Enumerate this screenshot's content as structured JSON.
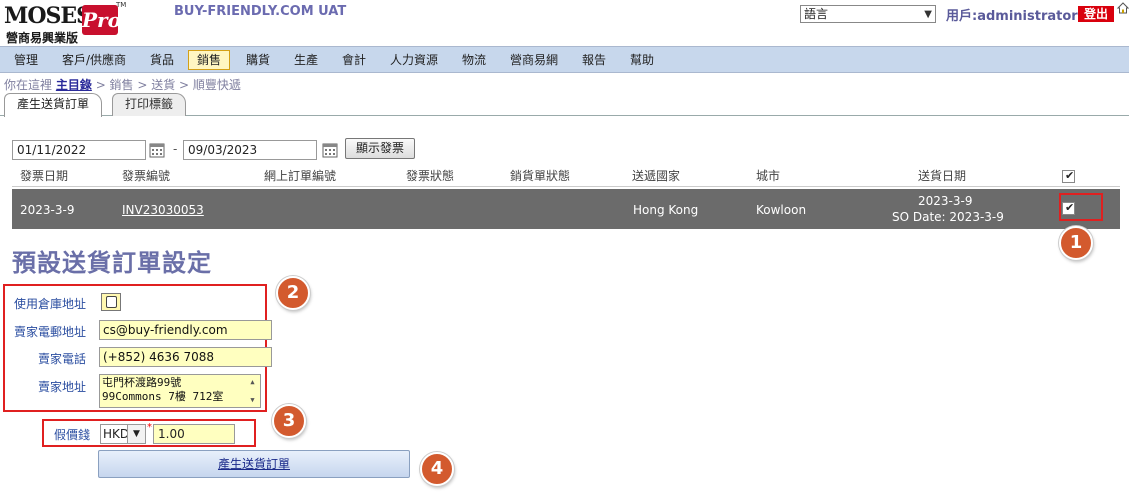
{
  "app": {
    "logo_main": "MOSES",
    "logo_pro": "Pro",
    "logo_tm": "TM",
    "logo_sub": "營商易興業版",
    "title": "BUY-FRIENDLY.COM UAT",
    "language_select": "語言",
    "user_label": "用戶:administrator",
    "logout_label": "登出"
  },
  "menu": {
    "items": [
      {
        "label": "管理"
      },
      {
        "label": "客戶/供應商"
      },
      {
        "label": "貨品"
      },
      {
        "label": "銷售"
      },
      {
        "label": "購貨"
      },
      {
        "label": "生產"
      },
      {
        "label": "會計"
      },
      {
        "label": "人力資源"
      },
      {
        "label": "物流"
      },
      {
        "label": "營商易網"
      },
      {
        "label": "報告"
      },
      {
        "label": "幫助"
      }
    ],
    "active_index": 3
  },
  "breadcrumb": {
    "prefix": "你在這裡",
    "home": "主目錄",
    "path": "> 銷售 > 送貨 > 順豐快遞"
  },
  "tabs": [
    {
      "label": "產生送貨訂單"
    },
    {
      "label": "打印標籤"
    }
  ],
  "filter": {
    "date_from": "01/11/2022",
    "date_sep": "-",
    "date_to": "09/03/2023",
    "show_button": "顯示發票"
  },
  "table": {
    "columns": [
      "發票日期",
      "發票編號",
      "網上訂單編號",
      "發票狀態",
      "銷貨單狀態",
      "送遞國家",
      "城市",
      "送貨日期"
    ],
    "rows": [
      {
        "invoice_date": "2023-3-9",
        "invoice_no": "INV23030053",
        "online_order_no": "",
        "invoice_status": "",
        "so_status": "",
        "country": "Hong Kong",
        "city": "Kowloon",
        "delivery_date": "2023-3-9",
        "so_date": "SO Date: 2023-3-9",
        "checked": true
      }
    ],
    "header_checked": true
  },
  "badges": [
    "1",
    "2",
    "3",
    "4"
  ],
  "section_title": "預設送貨訂單設定",
  "form": {
    "use_warehouse_label": "使用倉庫地址",
    "seller_email_label": "賣家電郵地址",
    "seller_email_value": "cs@buy-friendly.com",
    "seller_phone_label": "賣家電話",
    "seller_phone_value": "(+852) 4636 7088",
    "seller_address_label": "賣家地址",
    "seller_address_line1": "屯門杯渡路99號",
    "seller_address_line2": "99Commons 7樓 712室",
    "fake_price_label": "假價錢",
    "currency_value": "HKD",
    "required_mark": "*",
    "fake_price_value": "1.00",
    "create_button": "產生送貨訂單"
  },
  "colors": {
    "accent": "#6a6fa8",
    "menubar": "#c7d7ec",
    "highlight": "#e02020",
    "badge": "#d35a2e",
    "selected_row": "#6b6b6b",
    "input_bg": "#ffffc0"
  }
}
